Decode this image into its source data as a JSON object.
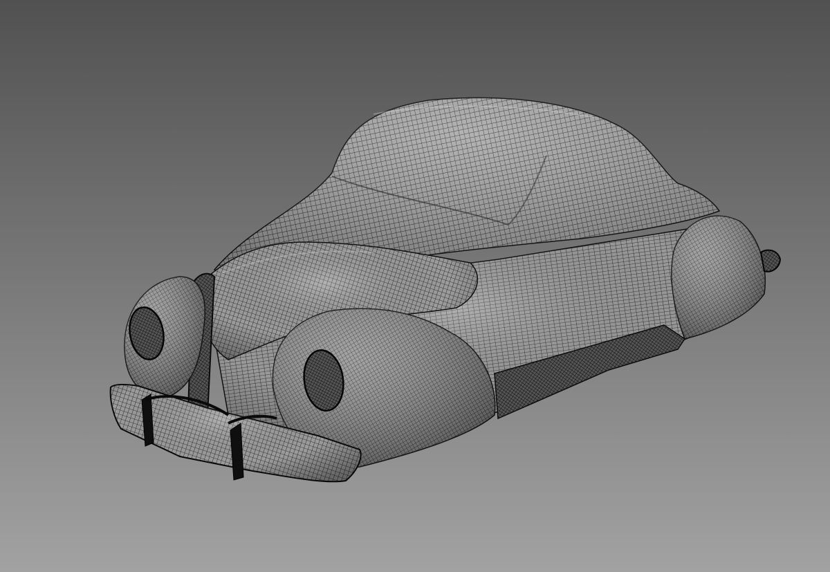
{
  "viewport": {
    "background_top": "#515151",
    "background_bottom": "#a2a2a2",
    "mesh_fill": "#9a9a9a",
    "mesh_line": "#161616",
    "mesh_highlight": "#d0d0d0"
  },
  "model": {
    "name": "car-body-mesh",
    "display_mode": "wireframe-on-shaded"
  }
}
